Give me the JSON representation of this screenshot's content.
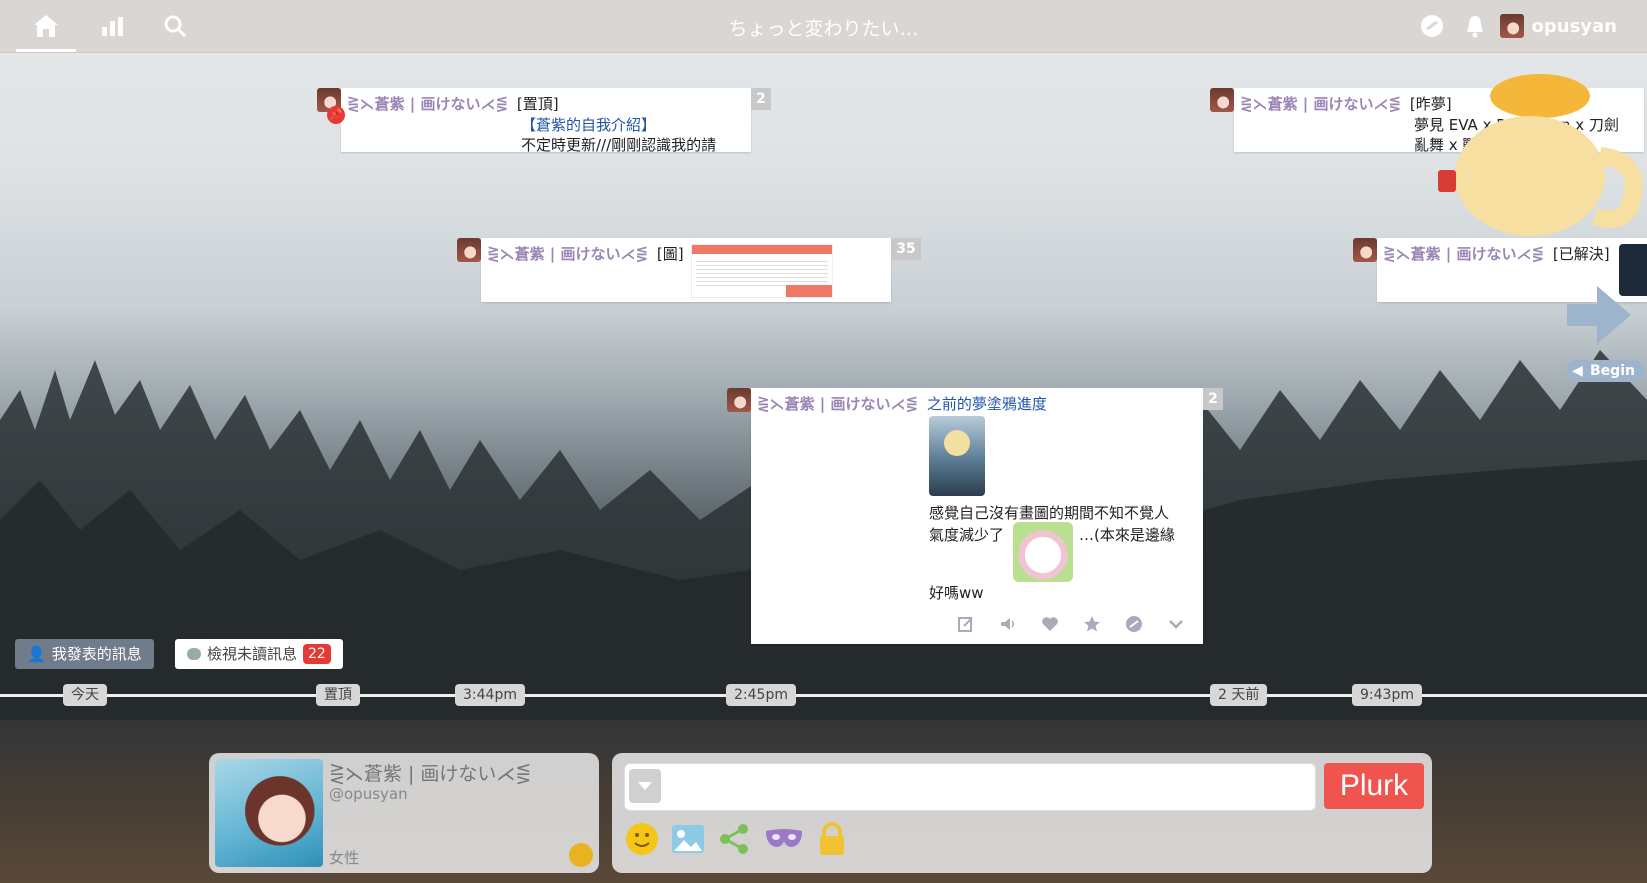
{
  "topbar": {
    "status_text": "ちょっと変わりたい…",
    "username": "opusyan"
  },
  "author_name": "⋛⋋蒼紫 | 画けない⋌⋚",
  "plurks": [
    {
      "qualifier": "[置頂]",
      "line1": "【蒼紫的自我介紹】",
      "line2": "不定時更新///剛剛認識我的請",
      "count": "2"
    },
    {
      "qualifier": "[昨夢]",
      "line1": "夢見 EVA x Poketmon x 刀劍",
      "line2": "亂舞 x 戰國時代 的夢",
      "count": ""
    },
    {
      "qualifier": "[圖]",
      "line1": "",
      "line2": "",
      "count": "35"
    },
    {
      "qualifier": "[已解決]",
      "line1": "",
      "line2": "",
      "count": ""
    },
    {
      "qualifier": "之前的夢塗鴉進度",
      "text1": "感覺自己沒有畫圖的期間不知不覺人",
      "text2a": "氣度減少了",
      "text2b": "…(本來是邊緣",
      "text3": "好嗎ww",
      "count": "2"
    }
  ],
  "filters": {
    "my_posts": "我發表的訊息",
    "unread": "檢視未讀訊息",
    "unread_count": "22"
  },
  "timeline_labels": [
    "今天",
    "置頂",
    "3:44pm",
    "2:45pm",
    "2 天前",
    "9:43pm"
  ],
  "begin_label": "Begin",
  "profile": {
    "display_name": "⋛⋋蒼紫 | 画けない⋌⋚",
    "handle": "@opusyan",
    "gender": "女性"
  },
  "composer": {
    "placeholder": "",
    "submit_label": "Plurk"
  },
  "colors": {
    "name_purple": "#9a86b4",
    "plurk_red": "#f0544f",
    "badge_red": "#e53935"
  }
}
